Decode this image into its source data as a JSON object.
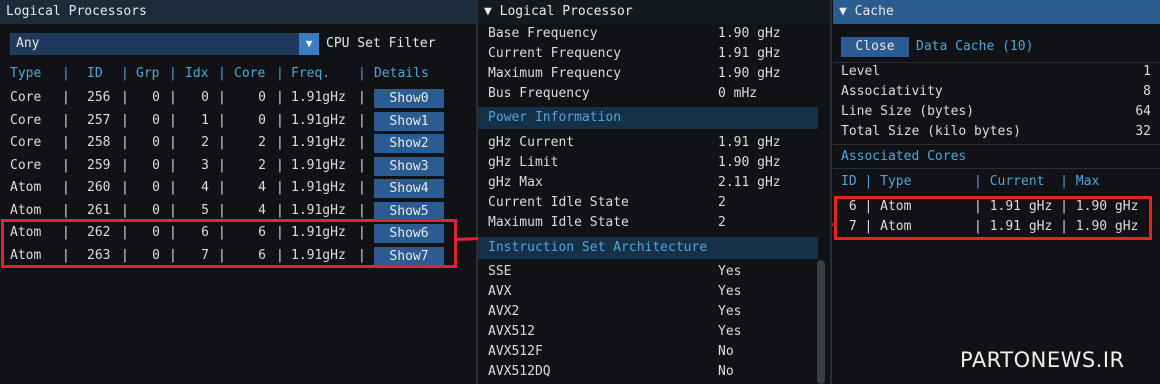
{
  "panel1": {
    "title": "Logical Processors",
    "combo_value": "Any",
    "combo_arrow": "▼",
    "filter_label": "CPU Set Filter",
    "headers": {
      "type": "Type",
      "id": "ID",
      "grp": "Grp",
      "idx": "Idx",
      "core": "Core",
      "freq": "Freq.",
      "details": "Details"
    },
    "rows": [
      {
        "type": "Core",
        "id": "256",
        "grp": "0",
        "idx": "0",
        "core": "0",
        "freq": "1.91gHz",
        "button": "Show0"
      },
      {
        "type": "Core",
        "id": "257",
        "grp": "0",
        "idx": "1",
        "core": "0",
        "freq": "1.91gHz",
        "button": "Show1"
      },
      {
        "type": "Core",
        "id": "258",
        "grp": "0",
        "idx": "2",
        "core": "2",
        "freq": "1.91gHz",
        "button": "Show2"
      },
      {
        "type": "Core",
        "id": "259",
        "grp": "0",
        "idx": "3",
        "core": "2",
        "freq": "1.91gHz",
        "button": "Show3"
      },
      {
        "type": "Atom",
        "id": "260",
        "grp": "0",
        "idx": "4",
        "core": "4",
        "freq": "1.91gHz",
        "button": "Show4"
      },
      {
        "type": "Atom",
        "id": "261",
        "grp": "0",
        "idx": "5",
        "core": "4",
        "freq": "1.91gHz",
        "button": "Show5"
      },
      {
        "type": "Atom",
        "id": "262",
        "grp": "0",
        "idx": "6",
        "core": "6",
        "freq": "1.91gHz",
        "button": "Show6"
      },
      {
        "type": "Atom",
        "id": "263",
        "grp": "0",
        "idx": "7",
        "core": "6",
        "freq": "1.91gHz",
        "button": "Show7"
      }
    ]
  },
  "panel2": {
    "title": "▼ Logical Processor",
    "freq": [
      {
        "key": "Base Frequency",
        "value": "1.90 gHz"
      },
      {
        "key": "Current Frequency",
        "value": "1.91 gHz"
      },
      {
        "key": "Maximum Frequency",
        "value": "1.90 gHz"
      },
      {
        "key": "Bus Frequency",
        "value": "0 mHz"
      }
    ],
    "power_title": "Power Information",
    "power": [
      {
        "key": "gHz Current",
        "value": "1.91 gHz"
      },
      {
        "key": "gHz Limit",
        "value": "1.90 gHz"
      },
      {
        "key": "gHz Max",
        "value": "2.11 gHz"
      },
      {
        "key": "Current Idle State",
        "value": "2"
      },
      {
        "key": "Maximum Idle State",
        "value": "2"
      }
    ],
    "isa_title": "Instruction Set Architecture",
    "isa": [
      {
        "key": "SSE",
        "value": "Yes"
      },
      {
        "key": "AVX",
        "value": "Yes"
      },
      {
        "key": "AVX2",
        "value": "Yes"
      },
      {
        "key": "AVX512",
        "value": "Yes"
      },
      {
        "key": "AVX512F",
        "value": "No"
      },
      {
        "key": "AVX512DQ",
        "value": "No"
      }
    ]
  },
  "panel3": {
    "title": "▼ Cache",
    "close_label": "Close",
    "cache_name": "Data Cache (10)",
    "props": [
      {
        "key": "Level",
        "value": "1"
      },
      {
        "key": "Associativity",
        "value": "8"
      },
      {
        "key": "Line Size (bytes)",
        "value": "64"
      },
      {
        "key": "Total Size (kilo bytes)",
        "value": "32"
      }
    ],
    "cores_title": "Associated Cores",
    "cores_header": "ID | Type        | Current  | Max",
    "cores": [
      " 6 | Atom        | 1.91 gHz | 1.90 gHz",
      " 7 | Atom        | 1.91 gHz | 1.90 gHz"
    ]
  },
  "watermark": "PARTONEWS.IR",
  "colors": {
    "accent": "#4ea6d6",
    "button": "#2c5b91",
    "highlight": "#e3242b"
  }
}
